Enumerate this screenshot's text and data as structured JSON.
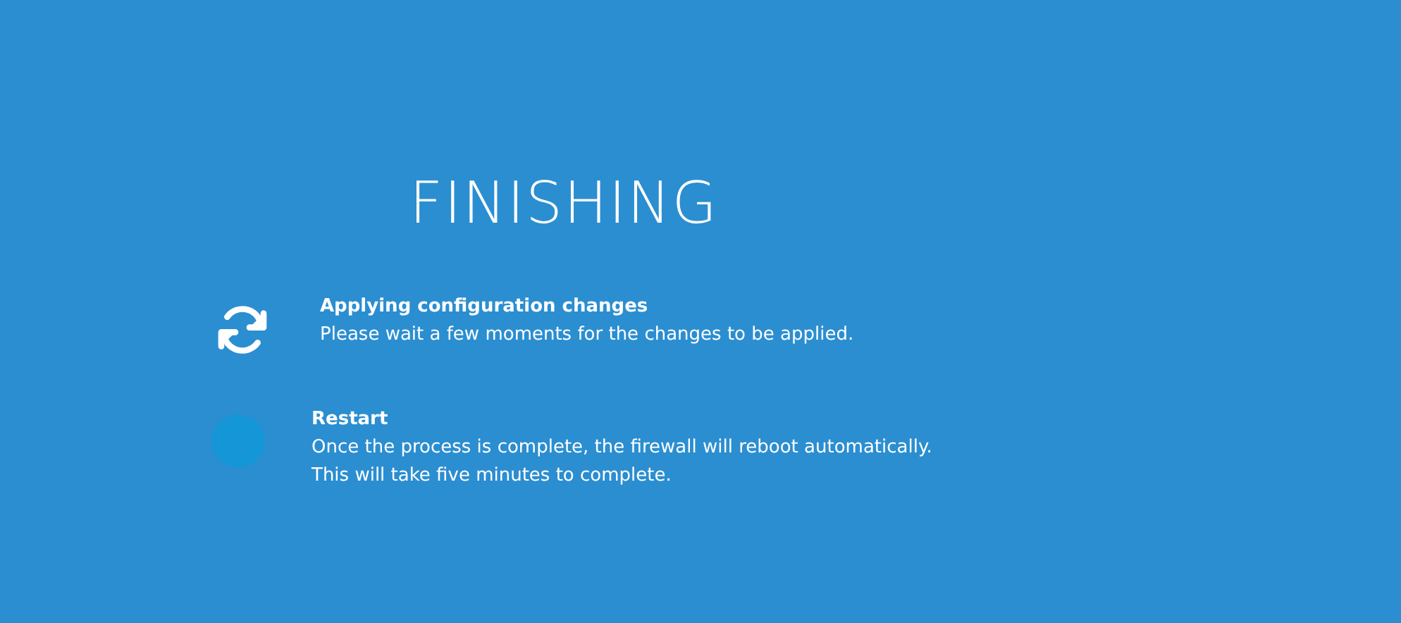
{
  "title": "FINISHING",
  "steps": [
    {
      "kind": "active",
      "heading": "Applying configuration changes",
      "description": "Please wait a few moments for the changes to be applied."
    },
    {
      "kind": "pending",
      "heading": "Restart",
      "description": "Once the process is complete, the firewall will reboot automatically. This will take five minutes to complete."
    }
  ]
}
